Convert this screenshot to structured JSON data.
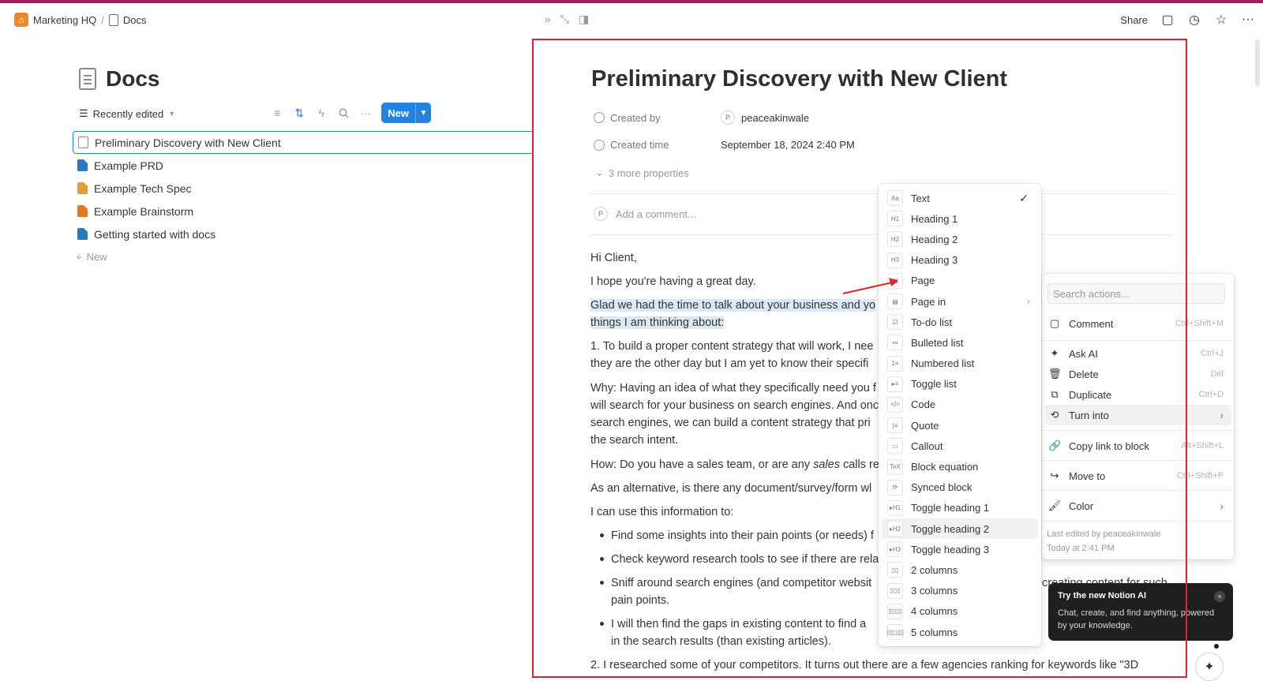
{
  "breadcrumb": {
    "workspace": "Marketing HQ",
    "sep": "/",
    "page": "Docs"
  },
  "left": {
    "title": "Docs",
    "view": "Recently edited",
    "new_button": "New",
    "docs": [
      "Preliminary Discovery with New Client",
      "Example PRD",
      "Example Tech Spec",
      "Example Brainstorm",
      "Getting started with docs"
    ],
    "new_row": "New"
  },
  "header": {
    "share": "Share"
  },
  "doc": {
    "title": "Preliminary Discovery with New Client",
    "created_by_label": "Created by",
    "created_by_avatar": "P",
    "created_by_value": "peaceakinwale",
    "created_time_label": "Created time",
    "created_time_value": "September 18, 2024 2:40 PM",
    "more_props": "3 more properties",
    "comment_avatar": "P",
    "comment_placeholder": "Add a comment...",
    "greeting_prefix": "Hi ",
    "greeting_name": "Client",
    "greeting_suffix": ",",
    "p1": "I hope you're having a great day.",
    "p2a": "Glad we had the time to talk about your business and yo",
    "p2b": "things I am thinking about:",
    "p3a": "1. To build a proper content strategy that will work, I nee",
    "p3b": "they are the other day but I am yet to know their specifi",
    "p4a": "Why: Having an idea of what they specifically need you f",
    "p4b": "will search for your business on search engines. And onc",
    "p4c": "search engines, we can build a content strategy that pri",
    "p4d": "the search intent.",
    "p5a": "How: Do you have a sales team, or are any ",
    "p5b": "sales",
    "p5c": " calls rec",
    "p6": "As an alternative, is there any document/survey/form wl",
    "p7": "I can use this information to:",
    "b1": "Find some insights into their pain points (or needs) f",
    "b2": "Check keyword research tools to see if there are rela",
    "b3a": "Sniff around search engines (and competitor websit",
    "b3b": "pain points.",
    "b3c": "creating content for such",
    "b4a": "I will then find the gaps in existing content to find a",
    "b4b": "in the search results (than existing articles).",
    "p8": "2. I researched some of your competitors. It turns out there are a few agencies ranking for keywords like \"3D"
  },
  "turn_into_menu": [
    {
      "label": "Text",
      "icon": "Aa",
      "checked": "✓"
    },
    {
      "label": "Heading 1",
      "icon": "H1"
    },
    {
      "label": "Heading 2",
      "icon": "H2"
    },
    {
      "label": "Heading 3",
      "icon": "H3"
    },
    {
      "label": "Page",
      "icon": "▤"
    },
    {
      "label": "Page in",
      "icon": "▤",
      "arrow": "›"
    },
    {
      "label": "To-do list",
      "icon": "☑"
    },
    {
      "label": "Bulleted list",
      "icon": "•≡"
    },
    {
      "label": "Numbered list",
      "icon": "1≡"
    },
    {
      "label": "Toggle list",
      "icon": "▸≡"
    },
    {
      "label": "Code",
      "icon": "</>"
    },
    {
      "label": "Quote",
      "icon": "|≡"
    },
    {
      "label": "Callout",
      "icon": "▭"
    },
    {
      "label": "Block equation",
      "icon": "TeX"
    },
    {
      "label": "Synced block",
      "icon": "⟳"
    },
    {
      "label": "Toggle heading 1",
      "icon": "▸H1"
    },
    {
      "label": "Toggle heading 2",
      "icon": "▸H2"
    },
    {
      "label": "Toggle heading 3",
      "icon": "▸H3"
    },
    {
      "label": "2 columns",
      "icon": "▯▯"
    },
    {
      "label": "3 columns",
      "icon": "▯▯▯"
    },
    {
      "label": "4 columns",
      "icon": "▯▯▯▯"
    },
    {
      "label": "5 columns",
      "icon": "▯▯▯▯▯"
    }
  ],
  "actions_menu": {
    "search_placeholder": "Search actions...",
    "comment": "Comment",
    "comment_sc": "Ctrl+Shift+M",
    "ask_ai": "Ask AI",
    "ask_ai_sc": "Ctrl+J",
    "delete": "Delete",
    "delete_sc": "Del",
    "duplicate": "Duplicate",
    "duplicate_sc": "Ctrl+D",
    "turn_into": "Turn into",
    "turn_into_arrow": "›",
    "copy_link": "Copy link to block",
    "copy_link_sc": "Alt+Shift+L",
    "move_to": "Move to",
    "move_to_sc": "Ctrl+Shift+P",
    "color": "Color",
    "color_arrow": "›",
    "last_edited": "Last edited by peaceakinwale",
    "last_edited_time": "Today at 2:41 PM"
  },
  "ai_tooltip": {
    "title": "Try the new Notion AI",
    "body": "Chat, create, and find anything, powered by your knowledge.",
    "close": "×"
  },
  "colors": {
    "accent": "#2383e2",
    "highlight": "#e0242c",
    "selection": "#dbe8f5"
  }
}
